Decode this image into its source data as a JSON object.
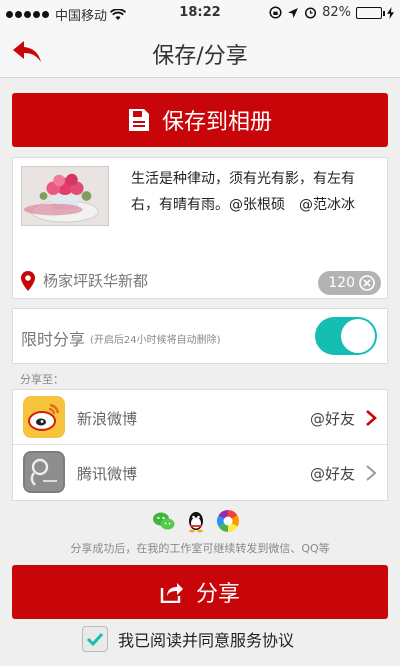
{
  "status_bar": {
    "carrier": "中国移动",
    "time": "18:22",
    "battery": "82%",
    "battery_level": 0.82
  },
  "nav": {
    "title": "保存/分享"
  },
  "save_button": {
    "label": "保存到相册"
  },
  "post": {
    "text": "生活是种律动，须有光有影，有左有右，有晴有雨。@张根硕　@范冰冰",
    "location": "杨家坪跃华新都",
    "remaining_chars": "120"
  },
  "limited_share": {
    "label": "限时分享",
    "note": "(开启后24小时候将自动删除)",
    "enabled": true
  },
  "share_to_label": "分享至：",
  "share_targets": [
    {
      "name": "新浪微博",
      "friends": "@好友",
      "icon": "sina-weibo-icon",
      "active": true
    },
    {
      "name": "腾讯微博",
      "friends": "@好友",
      "icon": "tencent-weibo-icon",
      "active": false
    }
  ],
  "hint": "分享成功后，在我的工作室可继续转发到微信、QQ等",
  "share_button": {
    "label": "分享"
  },
  "agreement": {
    "label": "我已阅读并同意服务协议",
    "checked": true
  },
  "colors": {
    "primary_red": "#c8060a",
    "toggle_teal": "#16bdb3"
  }
}
